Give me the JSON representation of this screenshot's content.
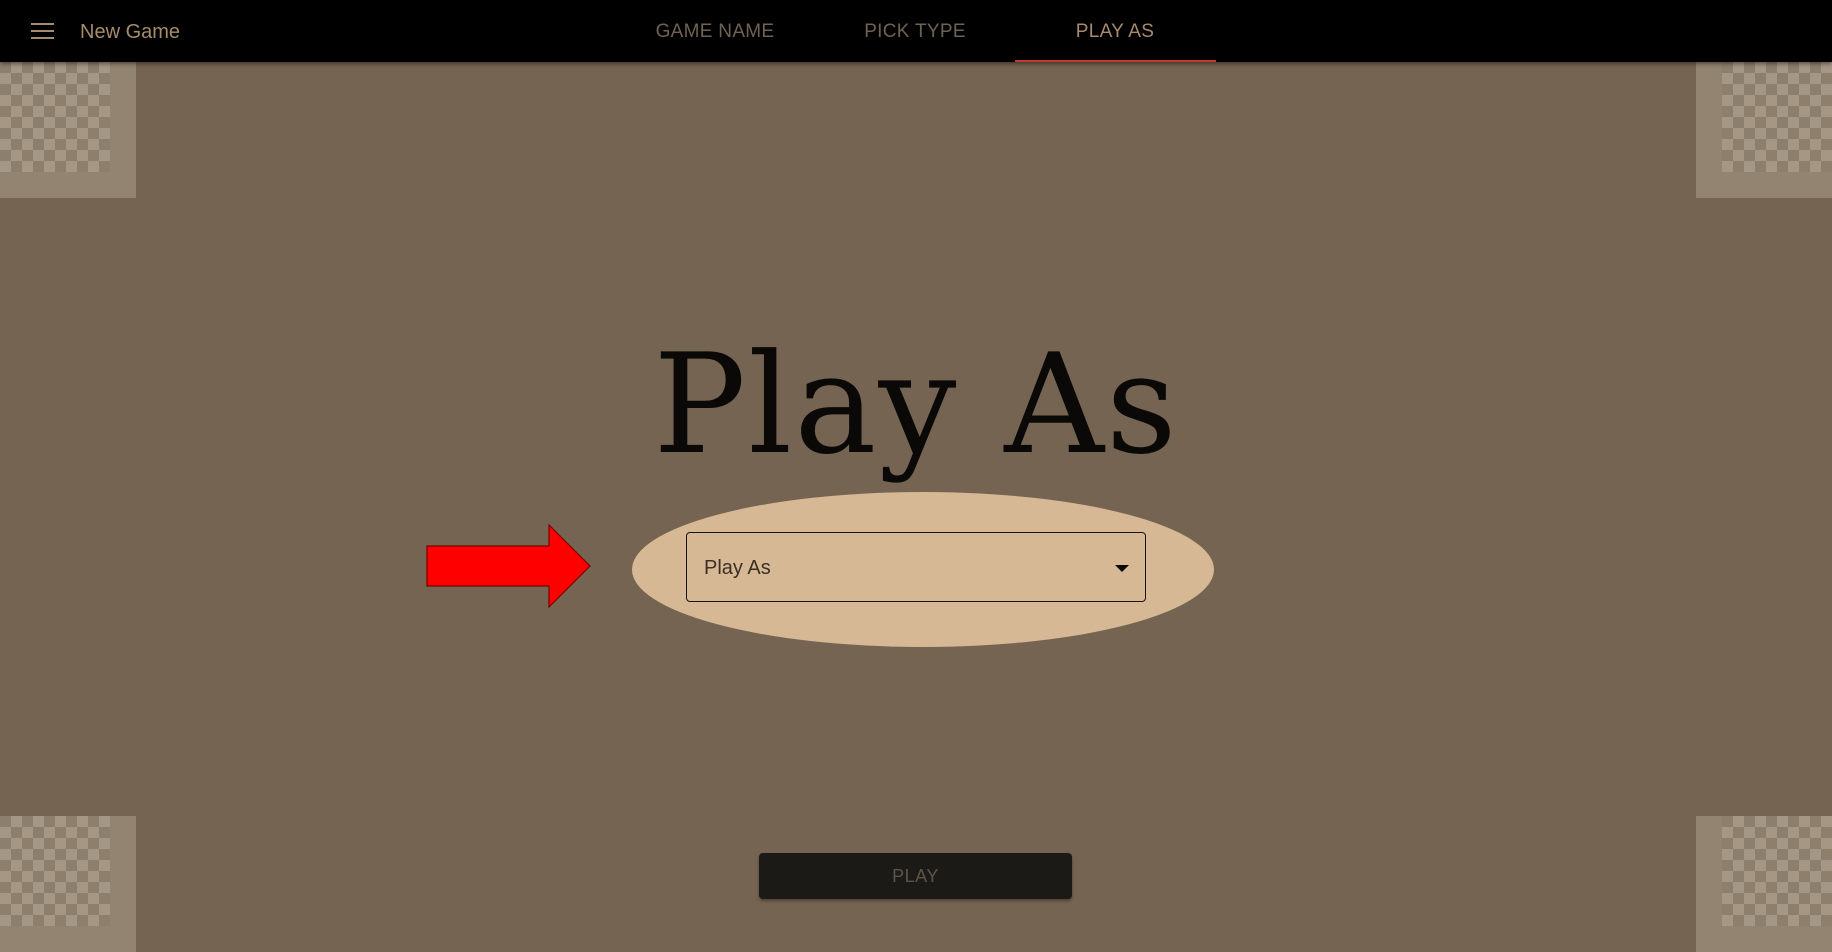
{
  "header": {
    "menu_icon": "hamburger-menu-icon",
    "title": "New Game",
    "tabs": [
      {
        "label": "GAME NAME",
        "active": false
      },
      {
        "label": "PICK TYPE",
        "active": false
      },
      {
        "label": "PLAY AS",
        "active": true
      }
    ]
  },
  "main": {
    "heading": "Play As",
    "select": {
      "label": "Play As",
      "icon": "caret-down-icon"
    },
    "annotation": {
      "icon": "red-arrow-right-icon",
      "highlight_color": "#d6b895",
      "arrow_color": "#ff0000"
    },
    "play_button": {
      "label": "PLAY",
      "disabled": true
    }
  },
  "theme": {
    "background": "#756451",
    "topbar": "#000000",
    "accent_text": "#a68b6c",
    "tab_indicator": "#c0392b"
  }
}
